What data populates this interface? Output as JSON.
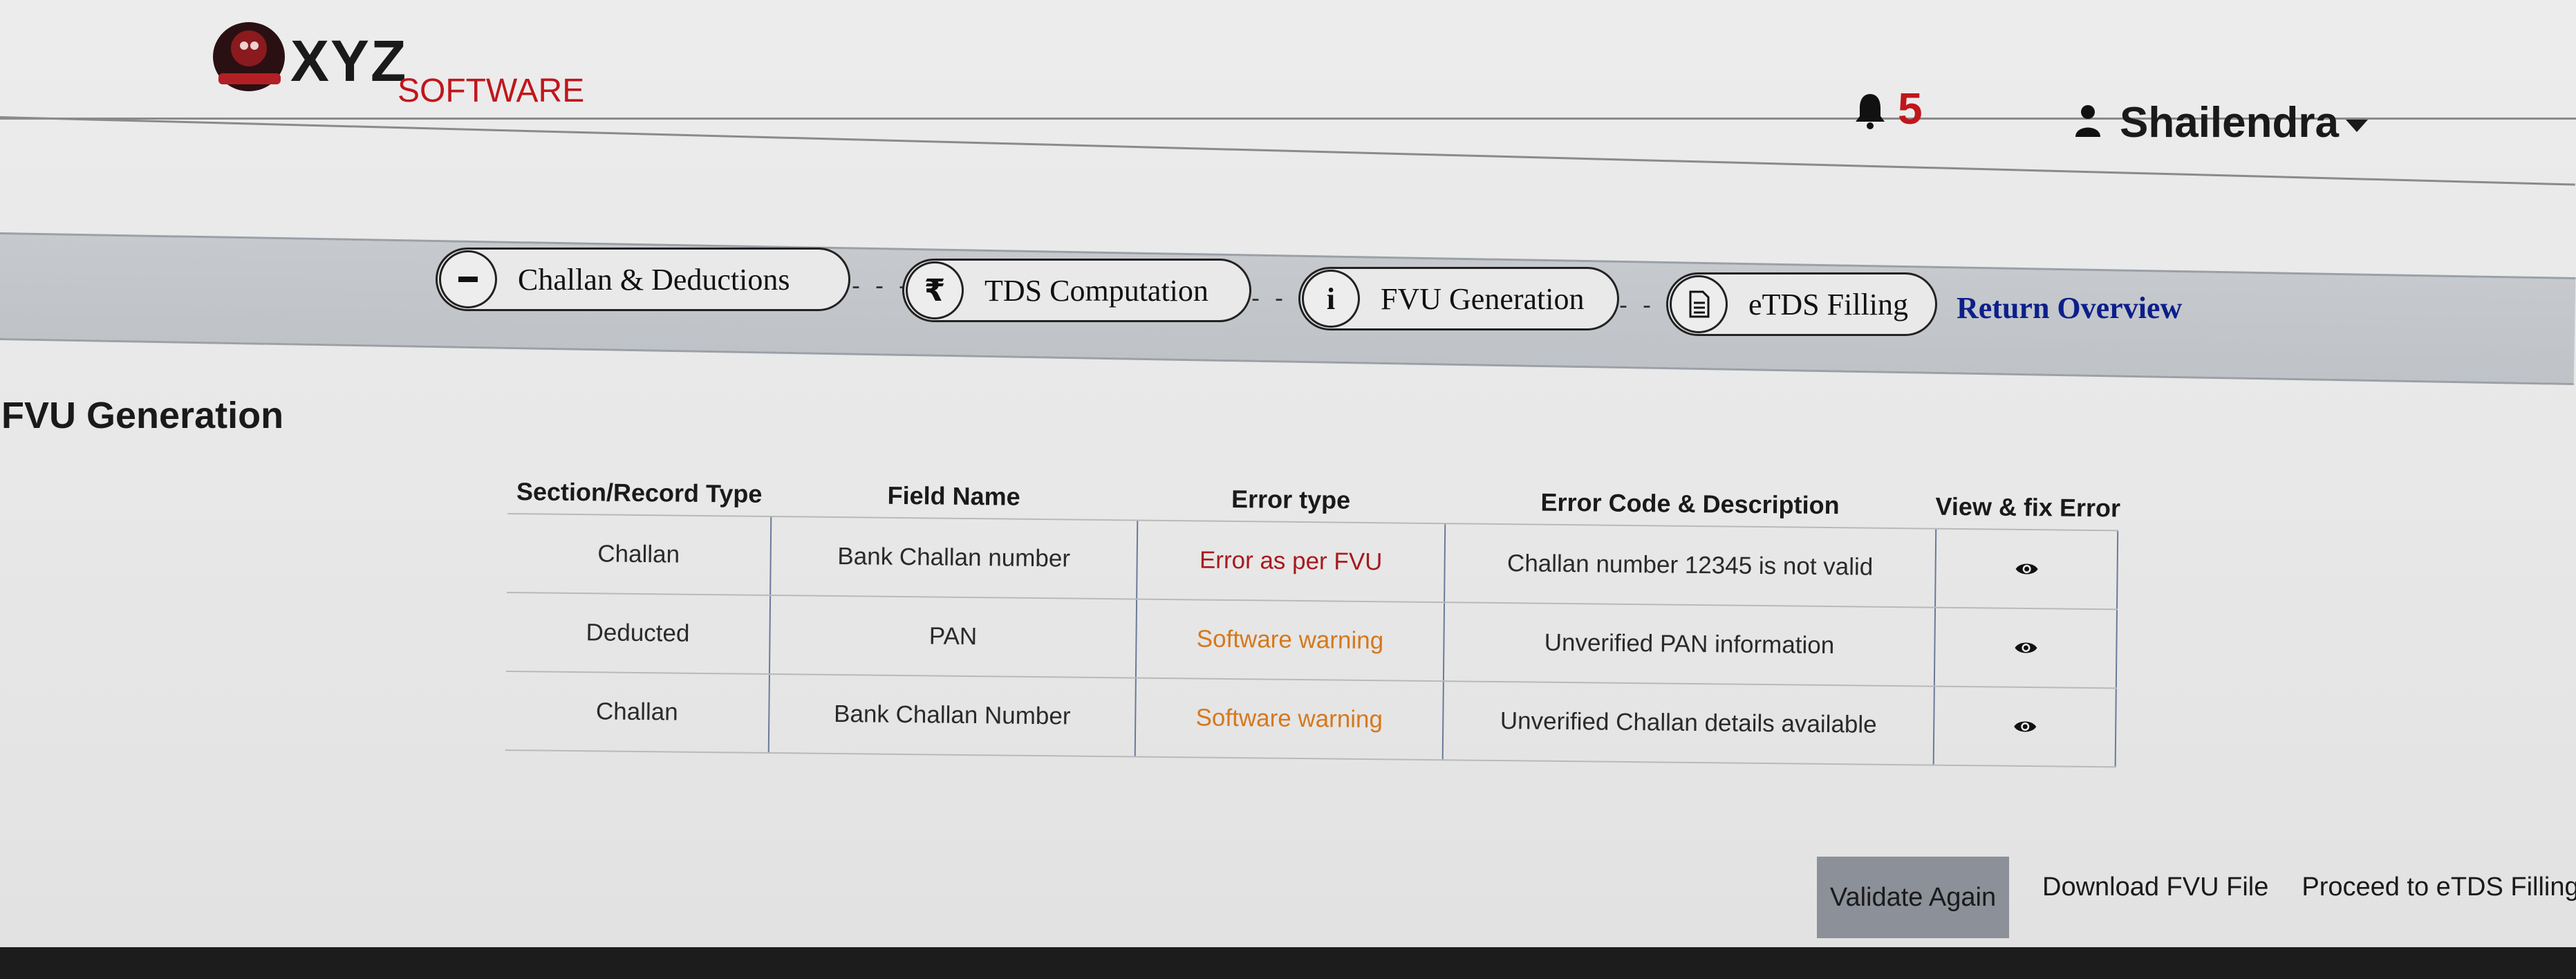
{
  "header": {
    "brand_main": "XYZ",
    "brand_sub": "SOFTWARE",
    "notification_count": "5",
    "user_name": "Shailendra"
  },
  "stepper": {
    "steps": [
      {
        "label": "Challan & Deductions",
        "icon": "minus-icon"
      },
      {
        "label": "TDS Computation",
        "icon": "rupee-icon"
      },
      {
        "label": "FVU Generation",
        "icon": "info-icon"
      },
      {
        "label": "eTDS Filling",
        "icon": "document-icon"
      }
    ],
    "return_overview": "Return Overview"
  },
  "page": {
    "title": "FVU Generation"
  },
  "table": {
    "headers": [
      "Section/Record Type",
      "Field Name",
      "Error type",
      "Error Code & Description",
      "View & fix Error"
    ],
    "rows": [
      {
        "section": "Challan",
        "field": "Bank Challan number",
        "error_type": "Error as per FVU",
        "description": "Challan number 12345 is not valid"
      },
      {
        "section": "Deducted",
        "field": "PAN",
        "error_type": "Software warning",
        "description": "Unverified PAN information"
      },
      {
        "section": "Challan",
        "field": "Bank Challan Number",
        "error_type": "Software warning",
        "description": "Unverified Challan details available"
      }
    ]
  },
  "actions": {
    "validate_again": "Validate Again",
    "download_fvu": "Download FVU File",
    "proceed_etds": "Proceed to eTDS Filling"
  },
  "colors": {
    "error_red": "#a8191c",
    "warning_orange": "#d6781b",
    "link_blue": "#0c1f8a",
    "brand_red": "#c0161c"
  }
}
